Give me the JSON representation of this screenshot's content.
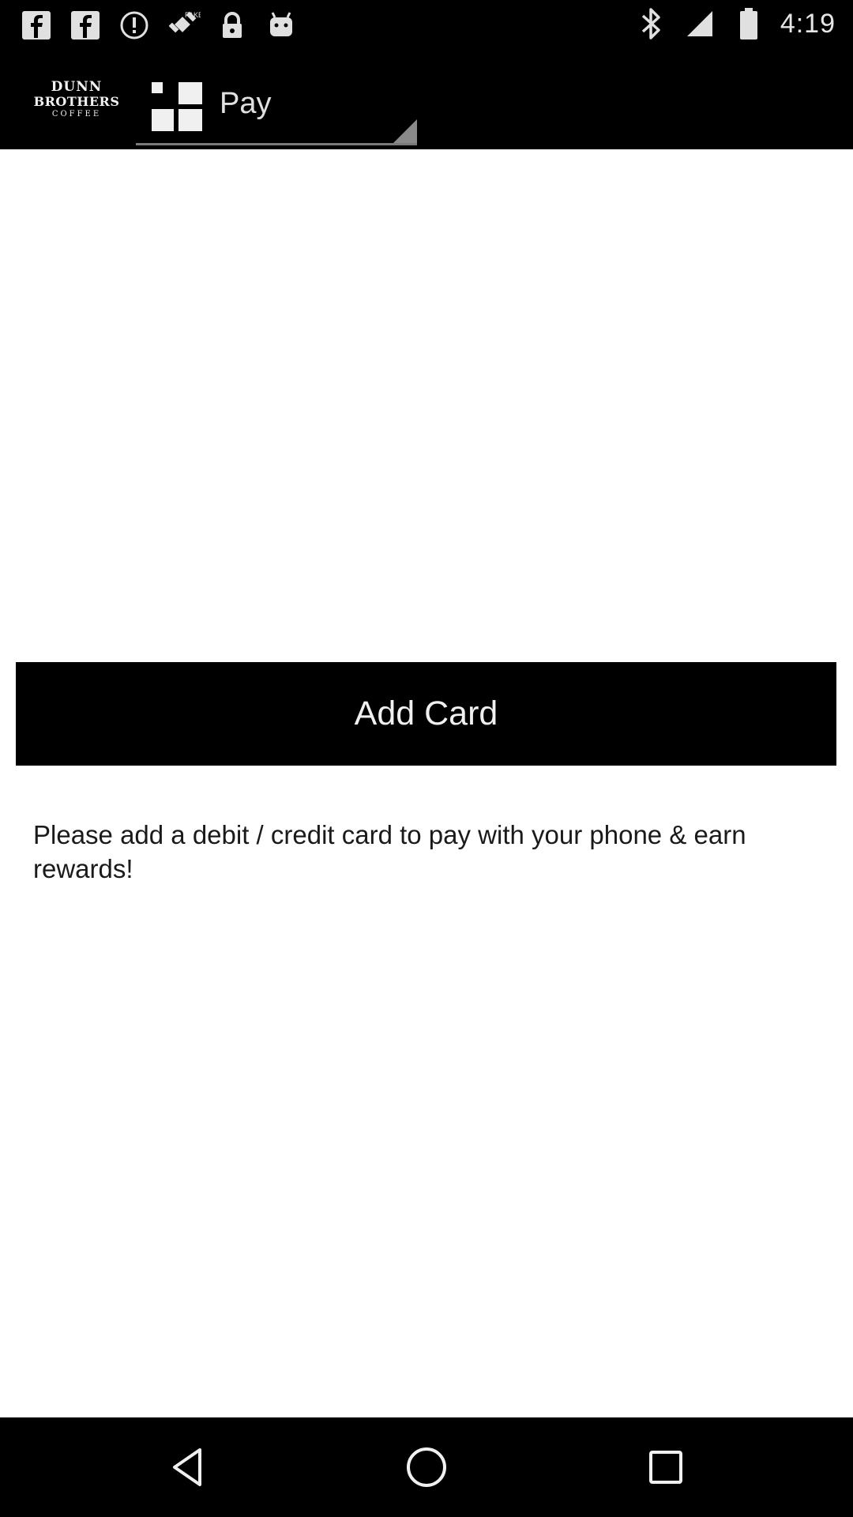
{
  "status_bar": {
    "time": "4:19",
    "left_icons": [
      "facebook-icon",
      "facebook-icon",
      "alert-icon",
      "fake-gps-icon",
      "lock-icon",
      "android-icon"
    ],
    "right_icons": [
      "bluetooth-icon"
    ]
  },
  "app_bar": {
    "logo": {
      "line1": "DUNN",
      "line2": "BROTHERS",
      "line3": "COFFEE"
    },
    "spinner": {
      "icon": "grid-icon",
      "label": "Pay"
    }
  },
  "main": {
    "add_card_label": "Add Card",
    "message": "Please add a debit / credit card to pay with your phone & earn rewards!"
  },
  "nav_bar": {
    "buttons": [
      "back-icon",
      "home-icon",
      "recents-icon"
    ]
  },
  "colors": {
    "bar_background": "#000000",
    "content_background": "#ffffff",
    "button_background": "#000000",
    "button_text": "#f0f0f0"
  }
}
